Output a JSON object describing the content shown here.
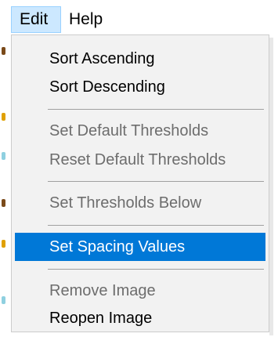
{
  "menubar": {
    "items": [
      {
        "label": "Edit"
      },
      {
        "label": "Help"
      }
    ]
  },
  "edit_menu": {
    "items": [
      {
        "label": "Sort Ascending",
        "enabled": true
      },
      {
        "label": "Sort Descending",
        "enabled": true
      },
      {
        "label": "Set Default Thresholds",
        "enabled": false
      },
      {
        "label": "Reset Default Thresholds",
        "enabled": false
      },
      {
        "label": "Set Thresholds Below",
        "enabled": false
      },
      {
        "label": "Set Spacing Values",
        "enabled": true,
        "highlighted": true
      },
      {
        "label": "Remove Image",
        "enabled": false
      },
      {
        "label": "Reopen Image",
        "enabled": true
      }
    ]
  },
  "colors": {
    "highlight": "#0078d7",
    "menubar_active": "#cce8ff",
    "disabled_text": "#6d6d6d",
    "menu_background": "#f2f2f2"
  }
}
